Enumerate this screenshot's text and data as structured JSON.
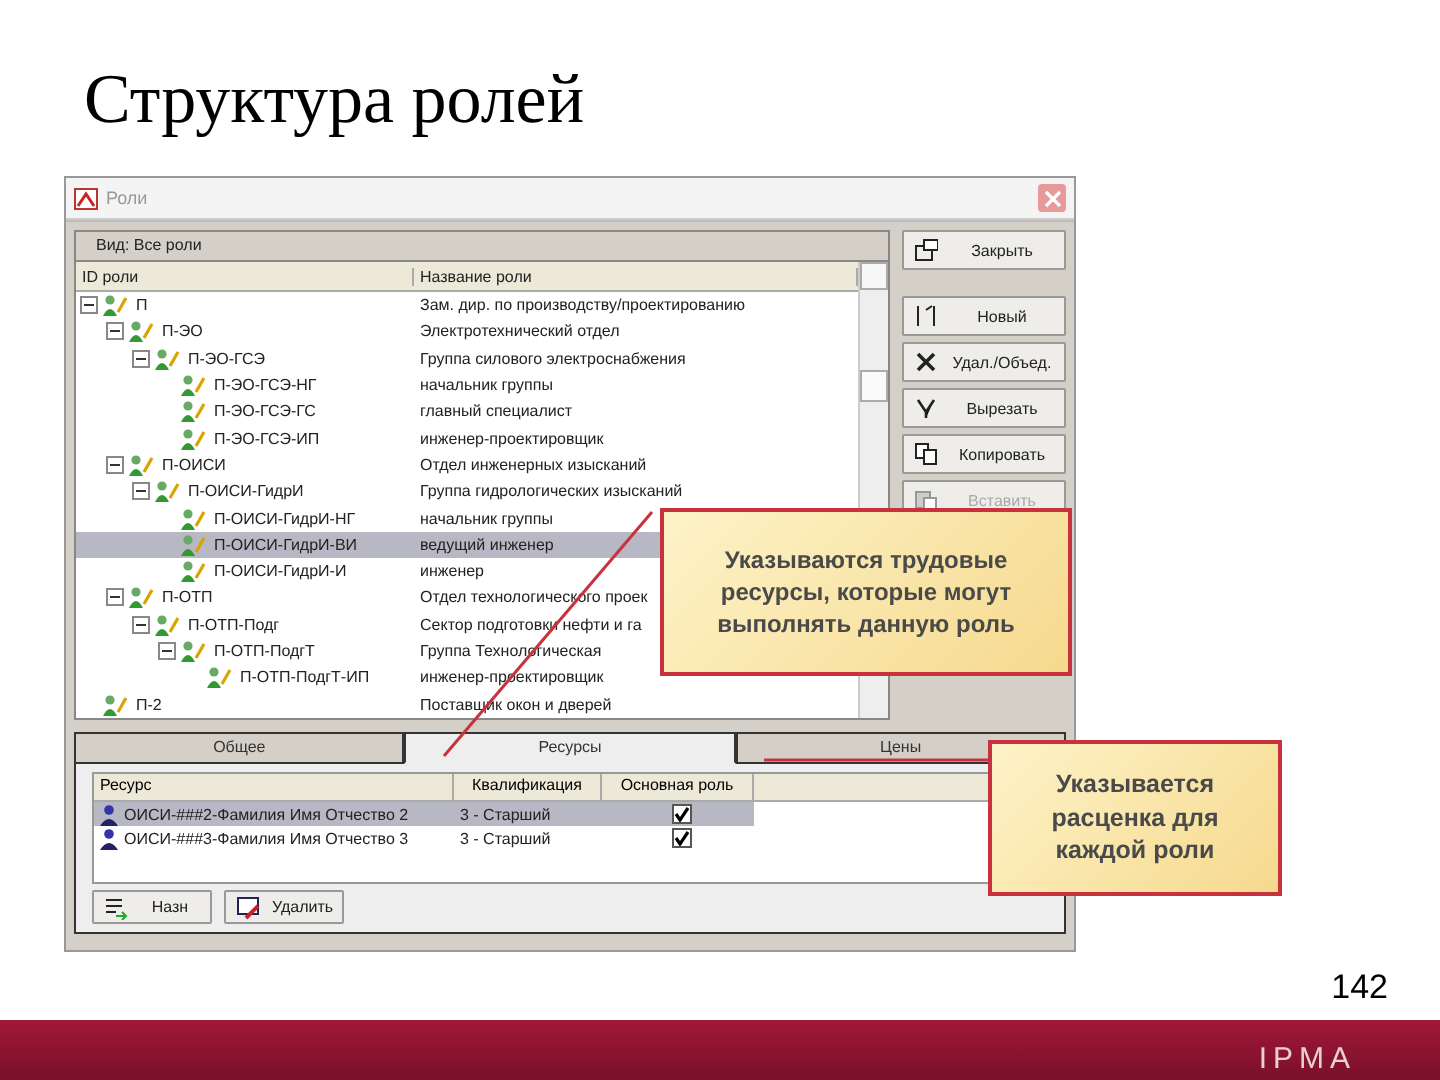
{
  "slide": {
    "title": "Структура ролей",
    "page_number": "142",
    "logo": "IPMA"
  },
  "window": {
    "title": "Роли",
    "view_filter": "Вид: Все роли",
    "tree": {
      "columns": [
        "ID роли",
        "Название роли"
      ],
      "rows": [
        {
          "id": "П",
          "name": "Зам. дир. по производству/проектированию",
          "expanded": true,
          "selected": false,
          "children": [
            {
              "id": "П-ЭО",
              "name": "Электротехнический отдел",
              "expanded": true,
              "selected": false,
              "children": [
                {
                  "id": "П-ЭО-ГСЭ",
                  "name": "Группа силового электроснабжения",
                  "expanded": true,
                  "selected": false,
                  "children": [
                    {
                      "id": "П-ЭО-ГСЭ-НГ",
                      "name": "начальник группы",
                      "selected": false
                    },
                    {
                      "id": "П-ЭО-ГСЭ-ГС",
                      "name": "главный специалист",
                      "selected": false
                    },
                    {
                      "id": "П-ЭО-ГСЭ-ИП",
                      "name": "инженер-проектировщик",
                      "selected": false
                    }
                  ]
                }
              ]
            },
            {
              "id": "П-ОИСИ",
              "name": "Отдел инженерных изысканий",
              "expanded": true,
              "selected": false,
              "children": [
                {
                  "id": "П-ОИСИ-ГидрИ",
                  "name": "Группа гидрологических изысканий",
                  "expanded": true,
                  "selected": false,
                  "children": [
                    {
                      "id": "П-ОИСИ-ГидрИ-НГ",
                      "name": "начальник группы",
                      "selected": false
                    },
                    {
                      "id": "П-ОИСИ-ГидрИ-ВИ",
                      "name": "ведущий инженер",
                      "selected": true
                    },
                    {
                      "id": "П-ОИСИ-ГидрИ-И",
                      "name": "инженер",
                      "selected": false
                    }
                  ]
                }
              ]
            },
            {
              "id": "П-ОТП",
              "name": "Отдел технологического проек",
              "expanded": true,
              "selected": false,
              "children": [
                {
                  "id": "П-ОТП-Подг",
                  "name": "Сектор подготовки нефти и га",
                  "expanded": true,
                  "selected": false,
                  "children": [
                    {
                      "id": "П-ОТП-ПодгТ",
                      "name": "Группа Технологическая",
                      "expanded": true,
                      "selected": false,
                      "children": [
                        {
                          "id": "П-ОТП-ПодгТ-ИП",
                          "name": "инженер-проектировщик",
                          "selected": false
                        }
                      ]
                    }
                  ]
                }
              ]
            }
          ]
        },
        {
          "id": "П-2",
          "name": "Поставщик окон и дверей",
          "selected": false
        }
      ]
    },
    "buttons": [
      {
        "label": "Закрыть",
        "disabled": false
      },
      {
        "label": "Новый",
        "disabled": false
      },
      {
        "label": "Удал./Объед.",
        "disabled": false
      },
      {
        "label": "Вырезать",
        "disabled": false
      },
      {
        "label": "Копировать",
        "disabled": false
      },
      {
        "label": "Вставить",
        "disabled": true
      }
    ],
    "tabs": [
      {
        "label": "Общее",
        "selected": false
      },
      {
        "label": "Ресурсы",
        "selected": true
      },
      {
        "label": "Цены",
        "selected": false
      }
    ],
    "resources": {
      "columns": [
        "Ресурс",
        "Квалификация",
        "Основная роль"
      ],
      "rows": [
        {
          "resource": "ОИСИ-###2-Фамилия Имя Отчество 2",
          "qualification": "3 - Старший",
          "primary": true,
          "selected": true
        },
        {
          "resource": "ОИСИ-###3-Фамилия Имя Отчество 3",
          "qualification": "3 - Старший",
          "primary": true,
          "selected": false
        }
      ]
    },
    "resource_buttons": [
      {
        "label": "Назн"
      },
      {
        "label": "Удалить"
      }
    ]
  },
  "callouts": [
    {
      "text": "Указываются трудовые ресурсы, которые могут выполнять данную роль"
    },
    {
      "text": "Указывается расценка для каждой роли"
    }
  ]
}
